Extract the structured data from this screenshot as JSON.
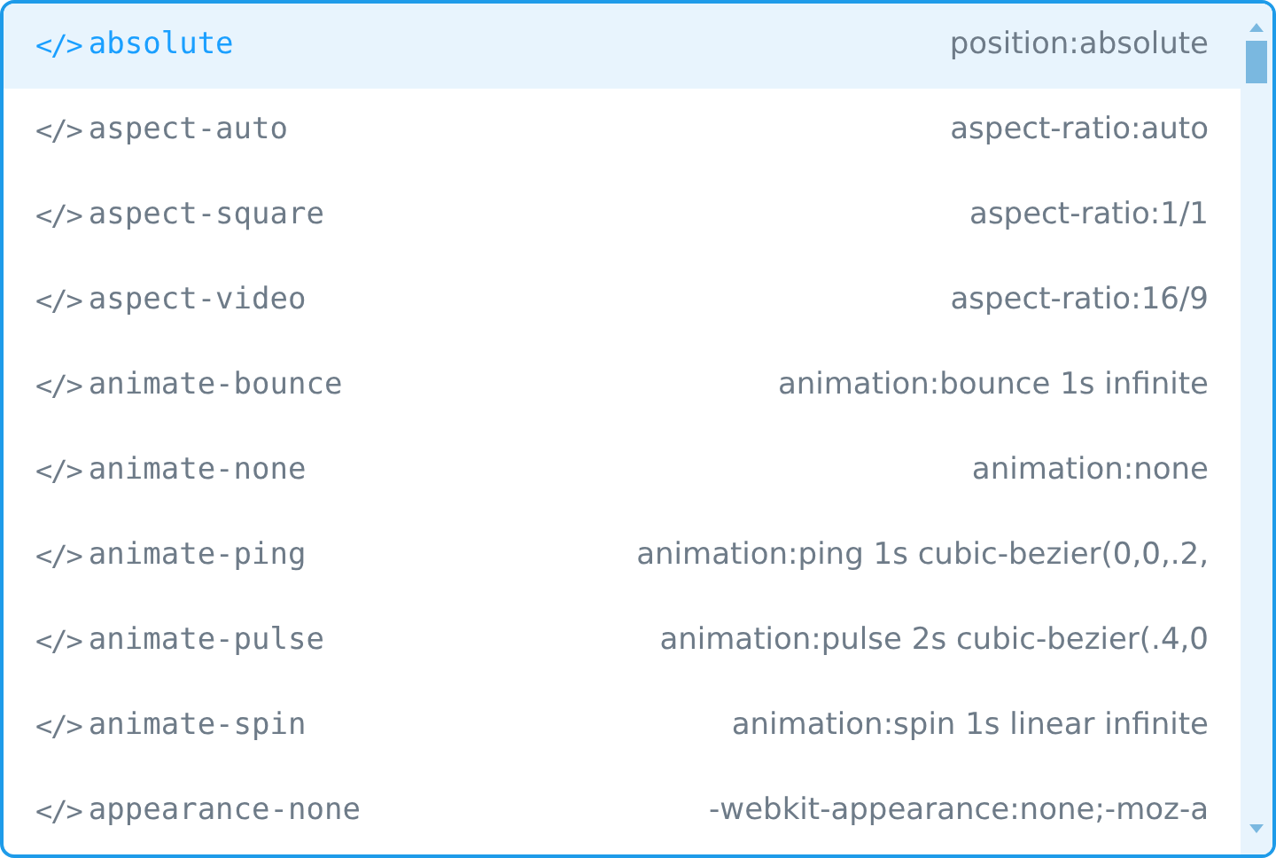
{
  "suggestions": [
    {
      "icon": "</>",
      "name": "absolute",
      "detail": "position:absolute",
      "selected": true
    },
    {
      "icon": "</>",
      "name": "aspect-auto",
      "detail": "aspect-ratio:auto",
      "selected": false
    },
    {
      "icon": "</>",
      "name": "aspect-square",
      "detail": "aspect-ratio:1/1",
      "selected": false
    },
    {
      "icon": "</>",
      "name": "aspect-video",
      "detail": "aspect-ratio:16/9",
      "selected": false
    },
    {
      "icon": "</>",
      "name": "animate-bounce",
      "detail": "animation:bounce 1s infinite",
      "selected": false
    },
    {
      "icon": "</>",
      "name": "animate-none",
      "detail": "animation:none",
      "selected": false
    },
    {
      "icon": "</>",
      "name": "animate-ping",
      "detail": "animation:ping 1s cubic-bezier(0,0,.2,",
      "selected": false
    },
    {
      "icon": "</>",
      "name": "animate-pulse",
      "detail": "animation:pulse 2s cubic-bezier(.4,0",
      "selected": false
    },
    {
      "icon": "</>",
      "name": "animate-spin",
      "detail": "animation:spin 1s linear infinite",
      "selected": false
    },
    {
      "icon": "</>",
      "name": "appearance-none",
      "detail": "-webkit-appearance:none;-moz-a",
      "selected": false
    }
  ]
}
